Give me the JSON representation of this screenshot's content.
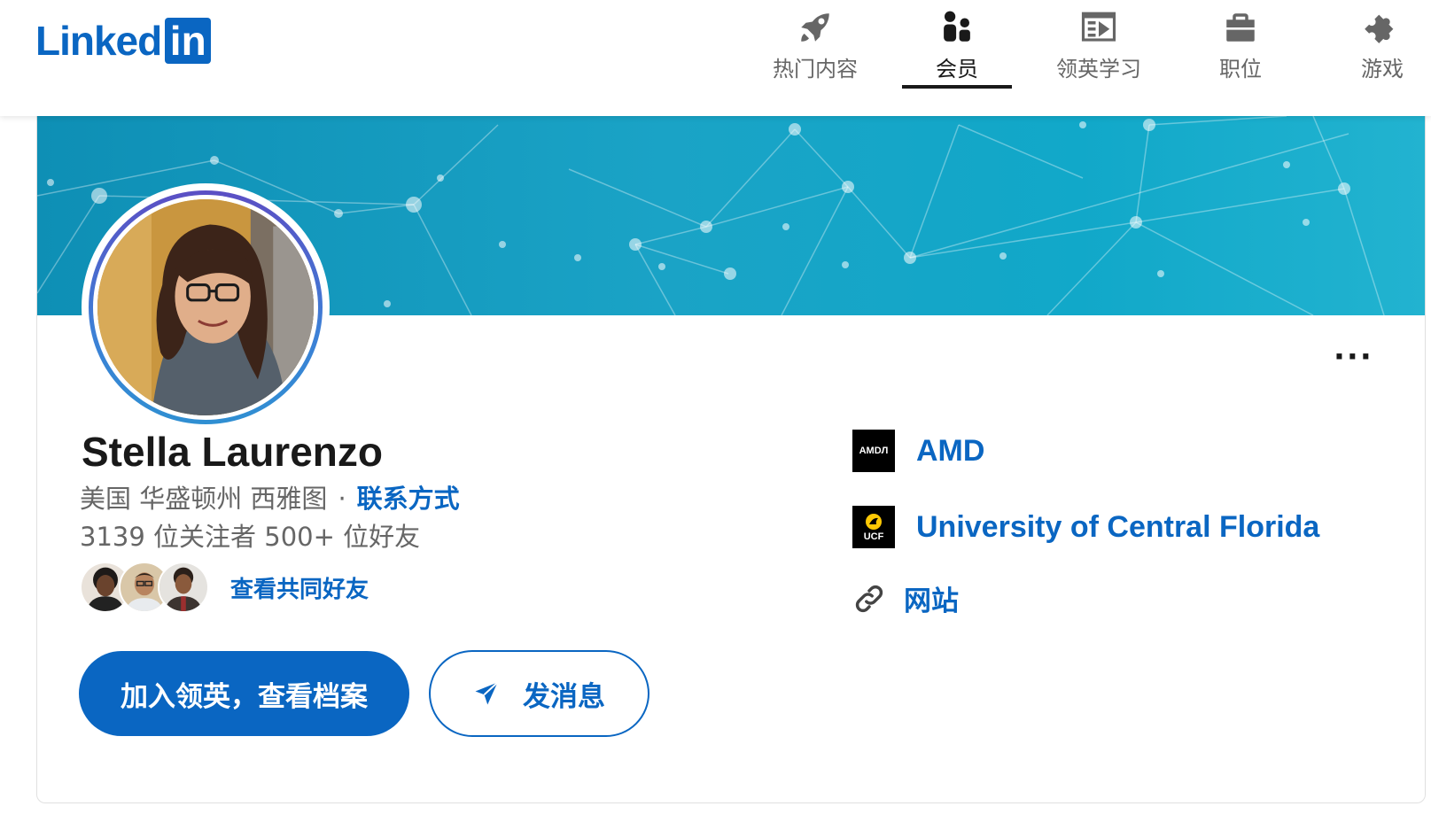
{
  "header": {
    "logo_text": "Linked",
    "logo_box_text": "in",
    "nav": [
      {
        "label": "热门内容",
        "icon": "rocket-icon"
      },
      {
        "label": "会员",
        "icon": "people-icon",
        "active": true
      },
      {
        "label": "领英学习",
        "icon": "video-player-icon"
      },
      {
        "label": "职位",
        "icon": "briefcase-icon"
      },
      {
        "label": "游戏",
        "icon": "puzzle-icon"
      }
    ]
  },
  "profile": {
    "name": "Stella Laurenzo",
    "location": "美国 华盛顿州 西雅图",
    "separator": "·",
    "contact_label": "联系方式",
    "followers": "3139 位关注者 500+ 位好友",
    "mutual_label": "查看共同好友",
    "more_label": "···"
  },
  "actions": {
    "primary_label": "加入领英，查看档案",
    "message_label": "发消息"
  },
  "sidebar": {
    "company": {
      "name": "AMD",
      "logo_text": "AMDЛ"
    },
    "school": {
      "name": "University of Central Florida",
      "logo_text": "UCF"
    },
    "website_label": "网站"
  },
  "colors": {
    "brand": "#0a66c2",
    "banner": "#1aa3c6"
  }
}
